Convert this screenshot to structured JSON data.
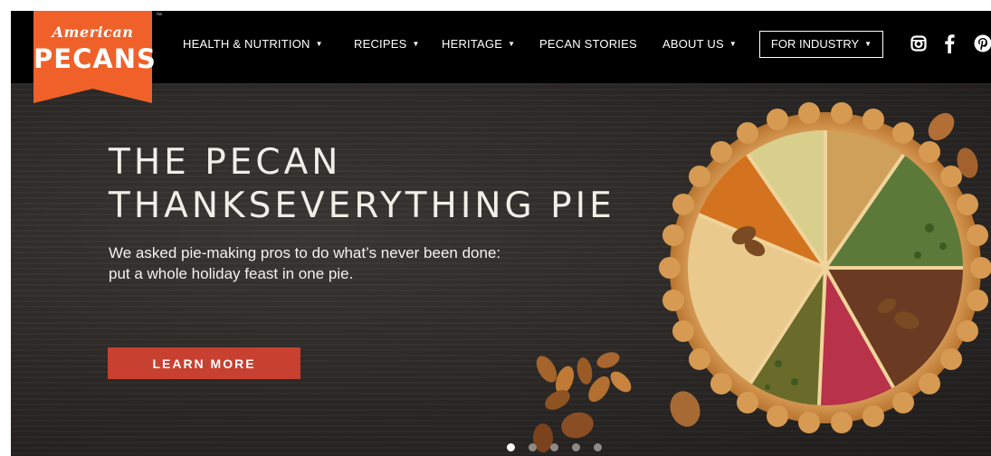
{
  "brand": {
    "script": "American",
    "wordmark": "PECANS",
    "trademark": "™",
    "color": "#f0612a"
  },
  "nav": {
    "items": [
      {
        "label": "HEALTH & NUTRITION",
        "dropdown": true
      },
      {
        "label": "RECIPES",
        "dropdown": true
      },
      {
        "label": "HERITAGE",
        "dropdown": true
      },
      {
        "label": "PECAN STORIES",
        "dropdown": false
      },
      {
        "label": "ABOUT US",
        "dropdown": true
      }
    ],
    "industry_label": "FOR INDUSTRY",
    "caret": "▼",
    "social": [
      "instagram-icon",
      "facebook-icon",
      "pinterest-icon"
    ]
  },
  "hero": {
    "headline_line1": "THE PECAN",
    "headline_line2": "THANKSEVERYTHING PIE",
    "sub_line1": "We asked pie-making pros to do what’s never been done:",
    "sub_line2": "put a whole holiday feast in one pie.",
    "cta_label": "LEARN MORE",
    "cta_color": "#c8402f",
    "slides_total": 5,
    "slide_active": 1
  }
}
